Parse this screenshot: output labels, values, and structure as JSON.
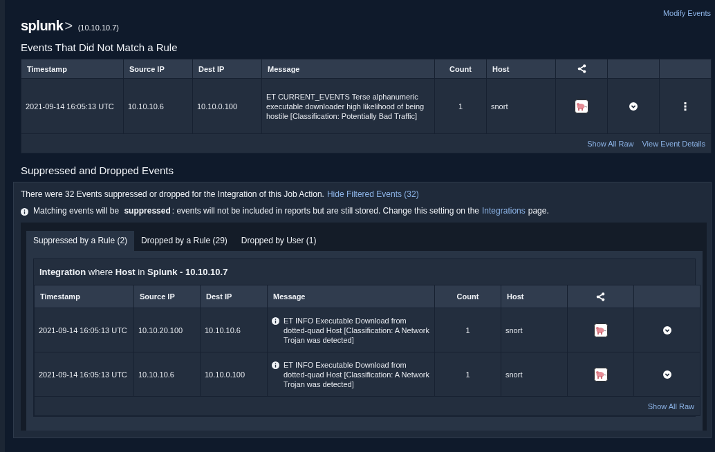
{
  "header": {
    "logo": {
      "word": "splunk",
      "mark": ">"
    },
    "host": "(10.10.10.7)",
    "action": "Modify Events"
  },
  "unmatched": {
    "title": "Events That Did Not Match a Rule",
    "columns": [
      {
        "kind": "text",
        "label": "Timestamp"
      },
      {
        "kind": "text",
        "label": "Source IP"
      },
      {
        "kind": "text",
        "label": "Dest IP"
      },
      {
        "kind": "text",
        "label": "Message"
      },
      {
        "kind": "number",
        "label": "Count"
      },
      {
        "kind": "text",
        "label": "Host"
      },
      {
        "kind": "share"
      },
      {
        "kind": "expand"
      },
      {
        "kind": "menu"
      }
    ],
    "rows": [
      {
        "info": false,
        "cells": [
          "2021-09-14 16:05:13 UTC",
          "10.10.10.6",
          "10.10.0.100",
          "ET CURRENT_EVENTS Terse alphanumeric executable downloader high likelihood of being hostile [Classification: Potentially Bad Traffic]",
          "1",
          "snort"
        ]
      }
    ],
    "links": [
      "Show All Raw",
      "View Event Details"
    ]
  },
  "filtered": {
    "title": "Suppressed and Dropped Events",
    "summary": "There were 32 Events suppressed or dropped for the Integration of this Job Action.",
    "summary_link": "Hide Filtered Events (32)",
    "note": {
      "text": "Matching events will be **suppressed**: events will not be included in reports but are still stored. Change this setting on the",
      "link": "Integrations",
      "after": "page."
    },
    "tabs": [
      {
        "label": "Suppressed by a Rule (2)",
        "selected": true
      },
      {
        "label": "Dropped by a Rule (29)",
        "selected": false
      },
      {
        "label": "Dropped by User (1)",
        "selected": false
      }
    ],
    "filter": "**Integration** where **Host** in **Splunk - 10.10.10.7**",
    "columns": [
      {
        "kind": "text",
        "label": "Timestamp"
      },
      {
        "kind": "text",
        "label": "Source IP"
      },
      {
        "kind": "text",
        "label": "Dest IP"
      },
      {
        "kind": "text",
        "label": "Message"
      },
      {
        "kind": "number",
        "label": "Count"
      },
      {
        "kind": "text",
        "label": "Host"
      },
      {
        "kind": "share"
      },
      {
        "kind": "expand"
      }
    ],
    "rows": [
      {
        "info": true,
        "cells": [
          "2021-09-14 16:05:13 UTC",
          "10.10.20.100",
          "10.10.10.6",
          "ET INFO Executable Download from dotted-quad Host [Classification: A Network Trojan was detected]",
          "1",
          "snort"
        ]
      },
      {
        "info": true,
        "cells": [
          "2021-09-14 16:05:13 UTC",
          "10.10.10.6",
          "10.10.0.100",
          "ET INFO Executable Download from dotted-quad Host [Classification: A Network Trojan was detected]",
          "1",
          "snort"
        ]
      }
    ],
    "links": [
      "Show All Raw"
    ]
  }
}
